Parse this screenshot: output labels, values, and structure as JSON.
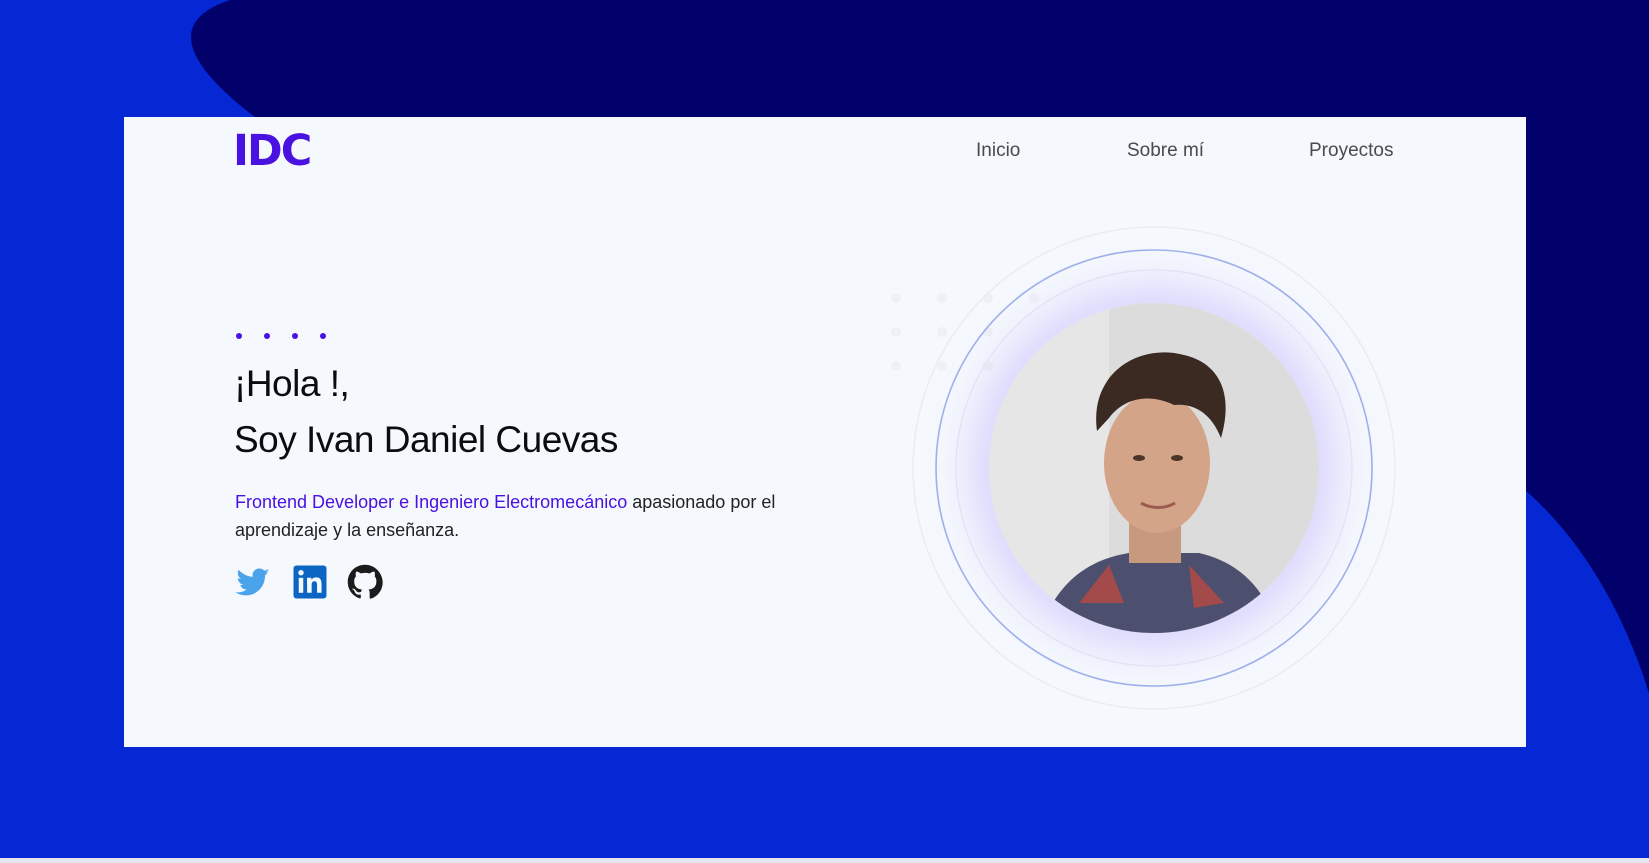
{
  "header": {
    "logo": "IDC",
    "nav": [
      "Inicio",
      "Sobre mí",
      "Proyectos"
    ]
  },
  "hero": {
    "greeting_line1": "¡Hola !,",
    "greeting_line2": "Soy Ivan Daniel Cuevas",
    "intro_highlight": "Frontend Developer e Ingeniero Electromecánico",
    "intro_rest": " apasionado por el aprendizaje y la enseñanza.",
    "social": [
      {
        "name": "twitter-icon",
        "label": "Twitter"
      },
      {
        "name": "linkedin-icon",
        "label": "LinkedIn"
      },
      {
        "name": "github-icon",
        "label": "GitHub"
      }
    ]
  },
  "colors": {
    "background": "#0527d4",
    "background_blob": "#02006b",
    "card": "#f5f8fd",
    "accent": "#4a12e0",
    "twitter": "#4ba3ec",
    "linkedin": "#0a66c2",
    "github": "#1b1b1b"
  }
}
